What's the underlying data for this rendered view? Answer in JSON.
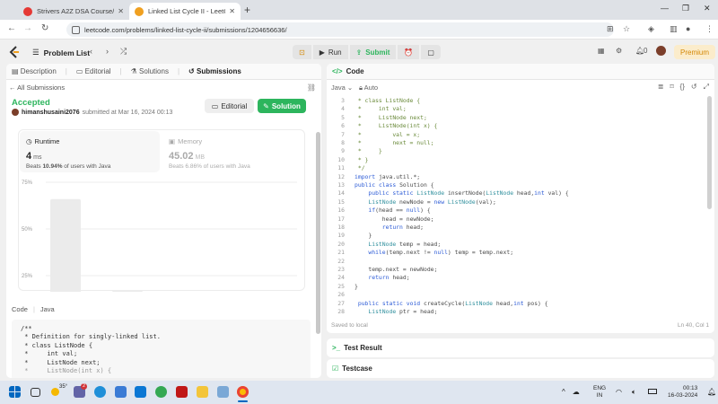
{
  "browser": {
    "tabs": [
      {
        "title": "Strivers A2Z DSA Course/Sheet",
        "color": "#e53935"
      },
      {
        "title": "Linked List Cycle II - LeetCode",
        "color": "#f0a020"
      }
    ],
    "url": "leetcode.com/problems/linked-list-cycle-ii/submissions/1204656636/"
  },
  "nav": {
    "problem_list": "Problem List",
    "run": "Run",
    "submit": "Submit",
    "coins": "0",
    "premium": "Premium"
  },
  "left": {
    "tabs": [
      "Description",
      "Editorial",
      "Solutions",
      "Submissions"
    ],
    "all_submissions": "All Submissions",
    "status": "Accepted",
    "user": "himanshusaini2076",
    "submitted": "submitted at Mar 16, 2024 00:13",
    "editorial_btn": "Editorial",
    "solution_btn": "Solution",
    "runtime": {
      "title": "Runtime",
      "value": "4",
      "unit": "ms",
      "beats_pre": "Beats",
      "beats_pct": "10.94%",
      "beats_post": "of users with Java"
    },
    "memory": {
      "title": "Memory",
      "value": "45.02",
      "unit": "MB",
      "beats": "Beats 6.86% of users with Java"
    },
    "code_tab": "Code",
    "code_lang": "Java",
    "code_preview": [
      "/**",
      " * Definition for singly-linked list.",
      " * class ListNode {",
      " *     int val;",
      " *     ListNode next;",
      " *     ListNode(int x) {"
    ]
  },
  "chart_data": {
    "type": "bar",
    "ylabel": "",
    "yticks": [
      "75%",
      "50%",
      "25%",
      "0%"
    ],
    "ylim": [
      0,
      75
    ],
    "categories": [
      "0ms",
      "1ms",
      "2ms",
      "3ms"
    ],
    "values": [
      66,
      17,
      2,
      4
    ],
    "highlight_category": "3ms",
    "mini_ticks": [
      "1ms",
      "2ms",
      "3ms"
    ]
  },
  "editor": {
    "title": "Code",
    "language": "Java",
    "mode": "Auto",
    "saved": "Saved to local",
    "cursor": "Ln 40, Col 1",
    "lines": [
      {
        "n": "3",
        "t": " * class ListNode {",
        "c": "cm"
      },
      {
        "n": "4",
        "t": " *     int val;",
        "c": "cm"
      },
      {
        "n": "5",
        "t": " *     ListNode next;",
        "c": "cm"
      },
      {
        "n": "6",
        "t": " *     ListNode(int x) {",
        "c": "cm"
      },
      {
        "n": "7",
        "t": " *         val = x;",
        "c": "cm"
      },
      {
        "n": "8",
        "t": " *         next = null;",
        "c": "cm"
      },
      {
        "n": "9",
        "t": " *     }",
        "c": "cm"
      },
      {
        "n": "10",
        "t": " * }",
        "c": "cm"
      },
      {
        "n": "11",
        "t": " */",
        "c": "cm"
      },
      {
        "n": "12",
        "t": "import java.util.*;",
        "c": ""
      },
      {
        "n": "13",
        "t": "public class Solution {",
        "c": ""
      },
      {
        "n": "14",
        "t": "    public static ListNode insertNode(ListNode head,int val) {",
        "c": ""
      },
      {
        "n": "15",
        "t": "    ListNode newNode = new ListNode(val);",
        "c": ""
      },
      {
        "n": "16",
        "t": "    if(head == null) {",
        "c": ""
      },
      {
        "n": "17",
        "t": "        head = newNode;",
        "c": ""
      },
      {
        "n": "18",
        "t": "        return head;",
        "c": ""
      },
      {
        "n": "19",
        "t": "    }",
        "c": ""
      },
      {
        "n": "20",
        "t": "    ListNode temp = head;",
        "c": ""
      },
      {
        "n": "21",
        "t": "    while(temp.next != null) temp = temp.next;",
        "c": ""
      },
      {
        "n": "22",
        "t": "",
        "c": ""
      },
      {
        "n": "23",
        "t": "    temp.next = newNode;",
        "c": ""
      },
      {
        "n": "24",
        "t": "    return head;",
        "c": ""
      },
      {
        "n": "25",
        "t": "}",
        "c": ""
      },
      {
        "n": "26",
        "t": "",
        "c": ""
      },
      {
        "n": "27",
        "t": " public static void createCycle(ListNode head,int pos) {",
        "c": ""
      },
      {
        "n": "28",
        "t": "    ListNode ptr = head;",
        "c": ""
      }
    ]
  },
  "panels": {
    "test_result": "Test Result",
    "testcase": "Testcase"
  },
  "taskbar": {
    "temp": "35°",
    "badge": "2",
    "lang": "ENG",
    "region": "IN",
    "time": "00:13",
    "date": "16-03-2024"
  }
}
